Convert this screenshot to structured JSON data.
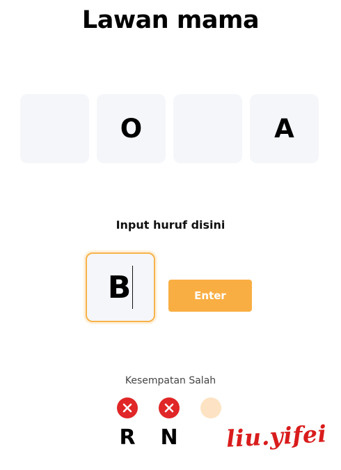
{
  "title": "Lawan mama",
  "slots": [
    "",
    "O",
    "",
    "A"
  ],
  "input": {
    "prompt": "Input huruf disini",
    "value": "B"
  },
  "enter_label": "Enter",
  "chances": {
    "label": "Kesempatan Salah",
    "wrong_letters": [
      "R",
      "N"
    ],
    "states": [
      "used",
      "used",
      "available"
    ],
    "colors": {
      "used": "#e02626",
      "available": "#fde3c3"
    }
  },
  "accent_color": "#f9ae43",
  "signature": "liu.yifei"
}
